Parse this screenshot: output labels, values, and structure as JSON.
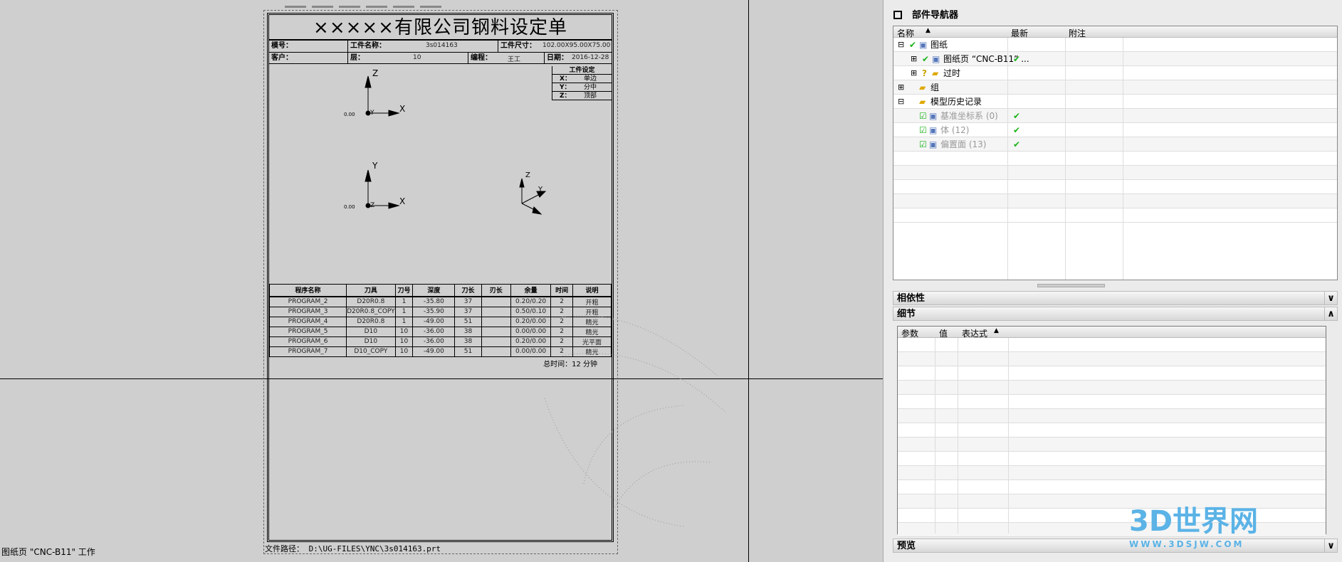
{
  "drawing": {
    "title": "×××××有限公司钢料设定单",
    "row1": {
      "l1": "模号：",
      "l2": "工件名称：",
      "v2": "3s014163",
      "l3": "工件尺寸：",
      "v3": "102.00X95.00X75.00"
    },
    "row2": {
      "l1": "客户：",
      "l2": "层：",
      "v2": "10",
      "l3": "编程：",
      "v3": "王工",
      "l4": "日期：",
      "v4": "2016-12-28"
    },
    "workpiece": {
      "title": "工件设定",
      "x": "X：",
      "xv": "单边",
      "y": "Y：",
      "yv": "分中",
      "z": "Z：",
      "zv": "顶部"
    },
    "axes": {
      "z": "Z",
      "x": "X",
      "y": "Y",
      "origin": "0.00",
      "side": "0.00"
    },
    "table": {
      "headers": [
        "程序名称",
        "刀具",
        "刀号",
        "深度",
        "刀长",
        "刃长",
        "余量",
        "时间",
        "说明"
      ],
      "rows": [
        [
          "PROGRAM_2",
          "D20R0.8",
          "1",
          "-35.80",
          "37",
          "",
          "0.20/0.20",
          "2",
          "开粗"
        ],
        [
          "PROGRAM_3",
          "D20R0.8_COPY",
          "1",
          "-35.90",
          "37",
          "",
          "0.50/0.10",
          "2",
          "开粗"
        ],
        [
          "PROGRAM_4",
          "D20R0.8",
          "1",
          "-49.00",
          "51",
          "",
          "0.20/0.00",
          "2",
          "精光"
        ],
        [
          "PROGRAM_5",
          "D10",
          "10",
          "-36.00",
          "38",
          "",
          "0.00/0.00",
          "2",
          "精光"
        ],
        [
          "PROGRAM_6",
          "D10",
          "10",
          "-36.00",
          "38",
          "",
          "0.20/0.00",
          "2",
          "光平面"
        ],
        [
          "PROGRAM_7",
          "D10_COPY",
          "10",
          "-49.00",
          "51",
          "",
          "0.00/0.00",
          "2",
          "精光"
        ]
      ]
    },
    "total": "总时间：12  分钟",
    "filepath": "文件路径： D:\\UG-FILES\\YNC\\3s014163.prt"
  },
  "status": "图纸页 \"CNC-B11\" 工作",
  "navigator": {
    "title": "部件导航器",
    "columns": [
      "名称",
      "最新",
      "附注"
    ],
    "items": [
      {
        "label": "图纸",
        "toggle": "⊟",
        "check": "✔",
        "latest": ""
      },
      {
        "label": "图纸页 “CNC-B11” ...",
        "toggle": "⊞",
        "check": "✔",
        "latest": "✔"
      },
      {
        "label": "过时",
        "toggle": "⊞",
        "check": "?",
        "latest": ""
      },
      {
        "label": "组",
        "toggle": "⊞",
        "check": "",
        "latest": ""
      },
      {
        "label": "模型历史记录",
        "toggle": "⊟",
        "check": "",
        "latest": ""
      },
      {
        "label": "基准坐标系 (0)",
        "check": "☑",
        "latest": "✔"
      },
      {
        "label": "体 (12)",
        "check": "☑",
        "latest": "✔"
      },
      {
        "label": "偏置面 (13)",
        "check": "☑",
        "latest": "✔"
      }
    ]
  },
  "panels": {
    "dependency": "相依性",
    "details": "细节",
    "preview": "预览",
    "down": "∨",
    "up": "∧"
  },
  "details_columns": [
    "参数",
    "值",
    "表达式"
  ],
  "watermark": {
    "name": "3D世界网",
    "url": "WWW.3DSJW.COM"
  }
}
